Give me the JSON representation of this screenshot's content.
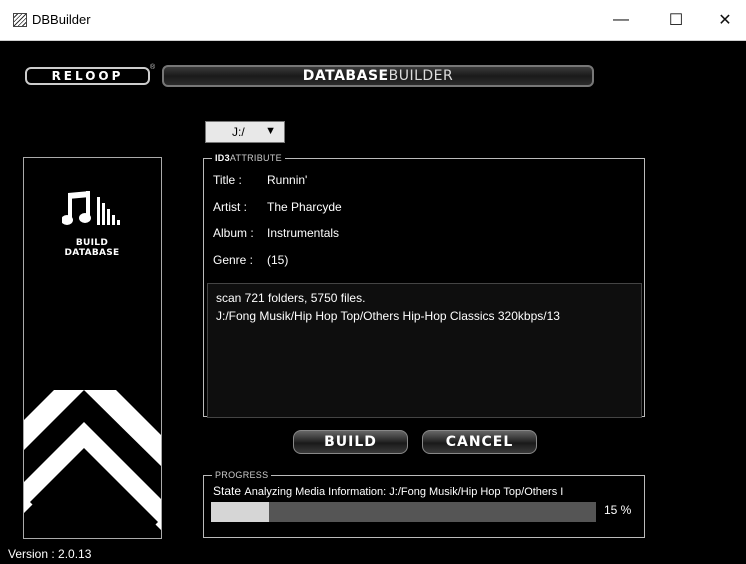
{
  "window": {
    "title": "DBBuilder",
    "minimize": "—",
    "maximize": "☐",
    "close": "✕"
  },
  "header": {
    "logo_text": "RELOOP",
    "logo_reg": "®",
    "banner_bold": "DATABASE",
    "banner_light": "BUILDER"
  },
  "sidebar": {
    "build_label_line1": "BUILD",
    "build_label_line2": "DATABASE"
  },
  "drive": {
    "value": "J:/",
    "arrow": "▼"
  },
  "id3": {
    "legend_bold": "ID3",
    "legend_rest": "ATTRIBUTE",
    "fields": [
      {
        "label": "Title :",
        "value": "Runnin'"
      },
      {
        "label": "Artist :",
        "value": "The Pharcyde"
      },
      {
        "label": "Album :",
        "value": "Instrumentals"
      },
      {
        "label": "Genre :",
        "value": "(15)"
      }
    ],
    "log_lines": [
      "scan 721 folders, 5750 files.",
      "J:/Fong Musik/Hip Hop Top/Others Hip-Hop Classics 320kbps/13"
    ]
  },
  "buttons": {
    "build": "BUILD",
    "cancel": "CANCEL"
  },
  "progress": {
    "legend": "PROGRESS",
    "state_label": "State",
    "state_value": "Analyzing Media Information: J:/Fong Musik/Hip Hop Top/Others I",
    "percent": 15,
    "percent_text": "15 %"
  },
  "footer": {
    "version": "Version : 2.0.13"
  }
}
